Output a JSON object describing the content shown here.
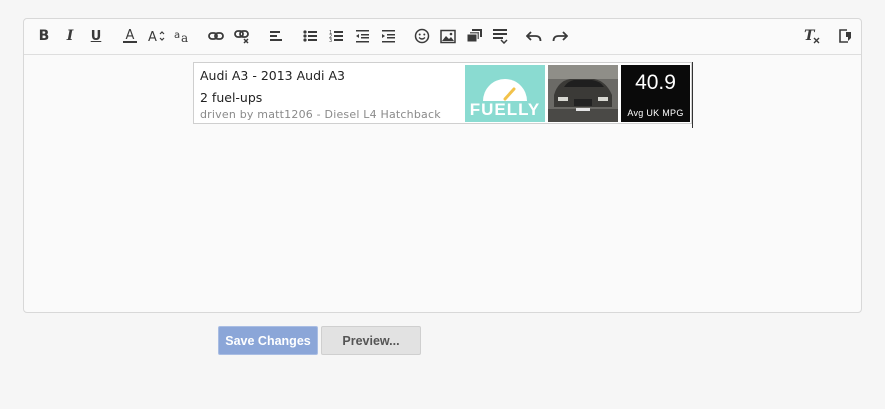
{
  "toolbar": {
    "buttons": [
      {
        "name": "bold-button",
        "icon": "bold-icon"
      },
      {
        "name": "italic-button",
        "icon": "italic-icon"
      },
      {
        "name": "underline-button",
        "icon": "underline-icon"
      },
      {
        "name": "text-color-button",
        "icon": "text-color-icon"
      },
      {
        "name": "font-size-button",
        "icon": "font-size-icon"
      },
      {
        "name": "font-family-button",
        "icon": "font-family-icon"
      },
      {
        "name": "insert-link-button",
        "icon": "link-icon"
      },
      {
        "name": "remove-link-button",
        "icon": "unlink-icon"
      },
      {
        "name": "align-button",
        "icon": "align-left-icon"
      },
      {
        "name": "bullet-list-button",
        "icon": "bullet-list-icon"
      },
      {
        "name": "numbered-list-button",
        "icon": "numbered-list-icon"
      },
      {
        "name": "outdent-button",
        "icon": "outdent-icon"
      },
      {
        "name": "indent-button",
        "icon": "indent-icon"
      },
      {
        "name": "smilies-button",
        "icon": "smiley-icon"
      },
      {
        "name": "insert-image-button",
        "icon": "image-icon"
      },
      {
        "name": "insert-media-button",
        "icon": "media-icon"
      },
      {
        "name": "insert-more-button",
        "icon": "insert-icon"
      },
      {
        "name": "undo-button",
        "icon": "undo-icon"
      },
      {
        "name": "redo-button",
        "icon": "redo-icon"
      },
      {
        "name": "remove-formatting-button",
        "icon": "remove-format-icon"
      },
      {
        "name": "toggle-bbcode-button",
        "icon": "toggle-bbcode-icon"
      }
    ]
  },
  "fuelly": {
    "title": "Audi A3 - 2013 Audi A3",
    "fuelups": "2 fuel-ups",
    "driven_by": "driven by matt1206 - Diesel L4 Hatchback",
    "logo_text": "FUELLY",
    "mpg_value": "40.9",
    "mpg_label": "Avg UK MPG",
    "logo_color": "#8adbd1"
  },
  "actions": {
    "save_label": "Save Changes",
    "preview_label": "Preview..."
  },
  "colors": {
    "save_button": "#8ba6d8",
    "preview_button": "#e2e2e2"
  }
}
